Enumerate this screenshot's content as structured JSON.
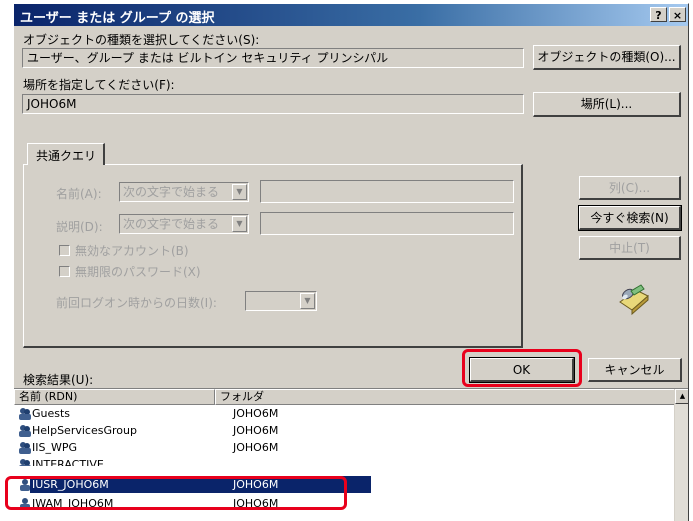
{
  "window": {
    "title": "ユーザー または グループ の選択"
  },
  "titlebar_buttons": [
    "?",
    "×"
  ],
  "object_type": {
    "label": "オブジェクトの種類を選択してください(S):",
    "value": "ユーザー、グループ または ビルトイン セキュリティ プリンシパル",
    "button": "オブジェクトの種類(O)..."
  },
  "location": {
    "label": "場所を指定してください(F):",
    "value": "JOHO6M",
    "button": "場所(L)..."
  },
  "tab": {
    "label": "共通クエリ"
  },
  "query": {
    "name_label": "名前(A):",
    "name_combo": "次の文字で始まる",
    "desc_label": "説明(D):",
    "desc_combo": "次の文字で始まる",
    "disabled_accounts": "無効なアカウント(B)",
    "no_expire_pwd": "無期限のパスワード(X)",
    "days_label": "前回ログオン時からの日数(I):"
  },
  "side_buttons": {
    "columns": "列(C)...",
    "search_now": "今すぐ検索(N)",
    "stop": "中止(T)"
  },
  "actions": {
    "ok": "OK",
    "cancel": "キャンセル"
  },
  "results": {
    "label": "検索結果(U):",
    "columns": [
      "名前 (RDN)",
      "フォルダ"
    ],
    "rows": [
      {
        "name": "Guests",
        "folder": "JOHO6M"
      },
      {
        "name": "HelpServicesGroup",
        "folder": "JOHO6M"
      },
      {
        "name": "IIS_WPG",
        "folder": "JOHO6M"
      },
      {
        "name": "INTERACTIVE",
        "folder": ""
      },
      {
        "name": "IUSR_JOHO6M",
        "folder": "JOHO6M",
        "selected": true
      },
      {
        "name": "IWAM_JOHO6M",
        "folder": "JOHO6M"
      }
    ]
  },
  "colors": {
    "highlight": "#e8001c",
    "selection": "#0a246a",
    "face": "#d4d0c8"
  }
}
